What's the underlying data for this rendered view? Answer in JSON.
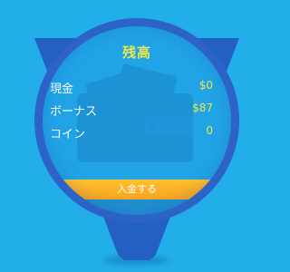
{
  "balance_panel": {
    "title": "残高",
    "rows": [
      {
        "label": "現金",
        "value": "$0"
      },
      {
        "label": "ボーナス",
        "value": "$87"
      },
      {
        "label": "コイン",
        "value": "0"
      }
    ],
    "deposit_button_label": "入金する"
  },
  "icons": {
    "background": "wallet-icon"
  },
  "colors": {
    "page_background": "#22aee9",
    "pin_ring": "#2d63c7",
    "pin_face": "#21a4e6",
    "title_and_values": "#f0e54b",
    "labels": "#ffffff",
    "deposit_button": "#ffc12e"
  }
}
